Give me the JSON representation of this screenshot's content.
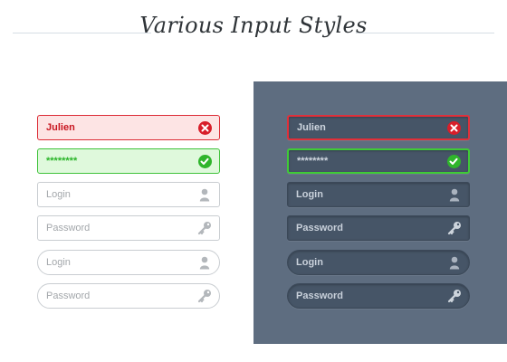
{
  "header": {
    "title": "Various Input Styles"
  },
  "light_column": {
    "error_field": {
      "value": "Julien",
      "icon": "error-x-icon"
    },
    "success_field": {
      "value": "********",
      "icon": "success-check-icon"
    },
    "login_field": {
      "placeholder": "Login",
      "icon": "user-icon"
    },
    "password_field": {
      "placeholder": "Password",
      "icon": "key-icon"
    },
    "login_pill_field": {
      "placeholder": "Login",
      "icon": "user-icon"
    },
    "password_pill_field": {
      "placeholder": "Password",
      "icon": "key-icon"
    }
  },
  "dark_column": {
    "error_field": {
      "value": "Julien",
      "icon": "error-x-icon"
    },
    "success_field": {
      "value": "********",
      "icon": "success-check-icon"
    },
    "login_field": {
      "placeholder": "Login",
      "icon": "user-icon"
    },
    "password_field": {
      "placeholder": "Password",
      "icon": "key-icon"
    },
    "login_pill_field": {
      "placeholder": "Login",
      "icon": "user-icon"
    },
    "password_pill_field": {
      "placeholder": "Password",
      "icon": "key-icon"
    }
  },
  "colors": {
    "error_red": "#d81e2a",
    "success_green": "#2fb52c",
    "dark_panel": "#5e6d80",
    "dark_field": "#465567"
  }
}
